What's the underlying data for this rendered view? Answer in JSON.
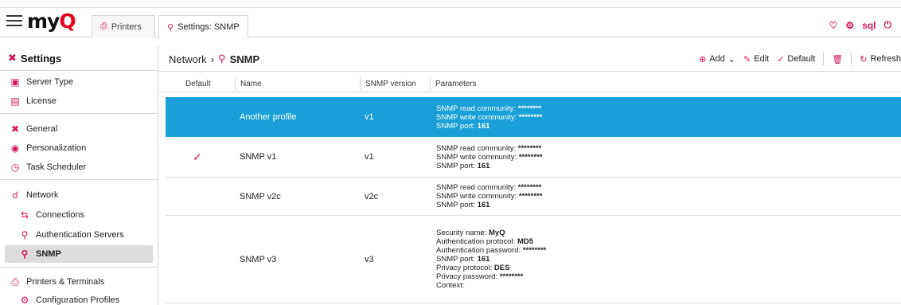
{
  "app": {
    "logo_text": "myQ",
    "logo_main": "my",
    "logo_q": "Q"
  },
  "tabs": [
    {
      "label": "Printers",
      "icon": "printer-icon"
    },
    {
      "label": "Settings: SNMP",
      "icon": "snmp-icon"
    }
  ],
  "topright": {
    "user": "sql"
  },
  "sidebar": {
    "title": "Settings",
    "items": [
      {
        "label": "Server Type",
        "icon": "server-icon"
      },
      {
        "label": "License",
        "icon": "license-icon"
      },
      {
        "label": "General",
        "icon": "tools-icon"
      },
      {
        "label": "Personalization",
        "icon": "palette-icon"
      },
      {
        "label": "Task Scheduler",
        "icon": "clock-icon"
      },
      {
        "label": "Network",
        "icon": "network-icon"
      },
      {
        "label": "Connections",
        "icon": "connections-icon"
      },
      {
        "label": "Authentication Servers",
        "icon": "auth-server-icon"
      },
      {
        "label": "SNMP",
        "icon": "snmp-icon"
      },
      {
        "label": "Printers & Terminals",
        "icon": "printer-icon"
      },
      {
        "label": "Configuration Profiles",
        "icon": "gear-icon"
      }
    ]
  },
  "breadcrumb": {
    "parent": "Network",
    "separator": "›",
    "current": "SNMP"
  },
  "toolbar": {
    "add": "Add",
    "edit": "Edit",
    "default": "Default",
    "refresh": "Refresh"
  },
  "table": {
    "headers": {
      "default": "Default",
      "name": "Name",
      "version": "SNMP version",
      "parameters": "Parameters"
    },
    "rows": [
      {
        "default": "",
        "name": "Another profile",
        "version": "v1",
        "params": [
          {
            "label": "SNMP read community:",
            "value": "********"
          },
          {
            "label": "SNMP write community:",
            "value": "********"
          },
          {
            "label": "SNMP port:",
            "value": "161"
          }
        ]
      },
      {
        "default": "✓",
        "name": "SNMP v1",
        "version": "v1",
        "params": [
          {
            "label": "SNMP read community:",
            "value": "********"
          },
          {
            "label": "SNMP write community:",
            "value": "********"
          },
          {
            "label": "SNMP port:",
            "value": "161"
          }
        ]
      },
      {
        "default": "",
        "name": "SNMP v2c",
        "version": "v2c",
        "params": [
          {
            "label": "SNMP read community:",
            "value": "********"
          },
          {
            "label": "SNMP write community:",
            "value": "********"
          },
          {
            "label": "SNMP port:",
            "value": "161"
          }
        ]
      },
      {
        "default": "",
        "name": "SNMP v3",
        "version": "v3",
        "params": [
          {
            "label": "Security name:",
            "value": "MyQ"
          },
          {
            "label": "Authentication protocol:",
            "value": "MD5"
          },
          {
            "label": "Authentication password:",
            "value": "********"
          },
          {
            "label": "SNMP port:",
            "value": "161"
          },
          {
            "label": "Privacy protocol:",
            "value": "DES"
          },
          {
            "label": "Privacy password:",
            "value": "********"
          },
          {
            "label": "Context:",
            "value": ""
          }
        ]
      }
    ]
  },
  "colors": {
    "accent": "#d4145a",
    "selection": "#1a9fd8"
  }
}
